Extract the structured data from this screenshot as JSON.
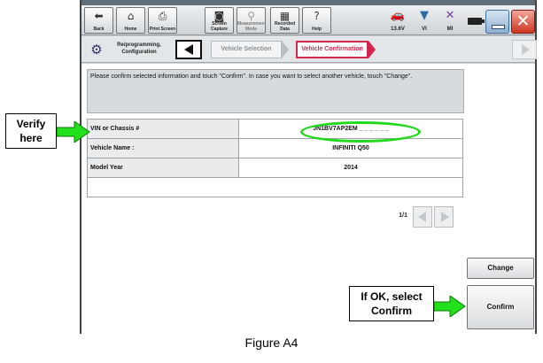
{
  "toolbar": {
    "buttons": [
      {
        "label": "Back",
        "icon": "back-arrow-icon"
      },
      {
        "label": "Home",
        "icon": "home-icon"
      },
      {
        "label": "Print Screen",
        "icon": "printer-icon"
      },
      {
        "label": "Screen Capture",
        "icon": "camera-icon"
      },
      {
        "label": "Measurement Mode",
        "icon": "measurement-icon"
      },
      {
        "label": "Recorded Data",
        "icon": "recorded-data-icon"
      },
      {
        "label": "Help",
        "icon": "help-icon"
      }
    ],
    "status": {
      "voltage": "13.6V",
      "vi_label": "VI",
      "mi_label": "MI"
    }
  },
  "breadcrumb": {
    "title": "Re/programming, Configuration",
    "step1": "Vehicle Selection",
    "step2": "Vehicle Confirmation"
  },
  "main": {
    "instruction": "Please confirm selected information and touch \"Confirm\". In case you want to select another vehicle, touch \"Change\".",
    "rows": [
      {
        "label": "VIN or Chassis #",
        "value": "JN1BV7AP2EM _ _ _ _ _ _"
      },
      {
        "label": "Vehicle Name :",
        "value": "INFINITI Q50"
      },
      {
        "label": "Model Year",
        "value": "2014"
      }
    ],
    "pager": "1/1",
    "change_label": "Change",
    "confirm_label": "Confirm"
  },
  "annotations": {
    "verify_line1": "Verify",
    "verify_line2": "here",
    "ok_line1": "If OK, select",
    "ok_line2": "Confirm",
    "arrow_color": "#22e01a",
    "highlight_color": "#1ed81a"
  },
  "caption": "Figure A4"
}
